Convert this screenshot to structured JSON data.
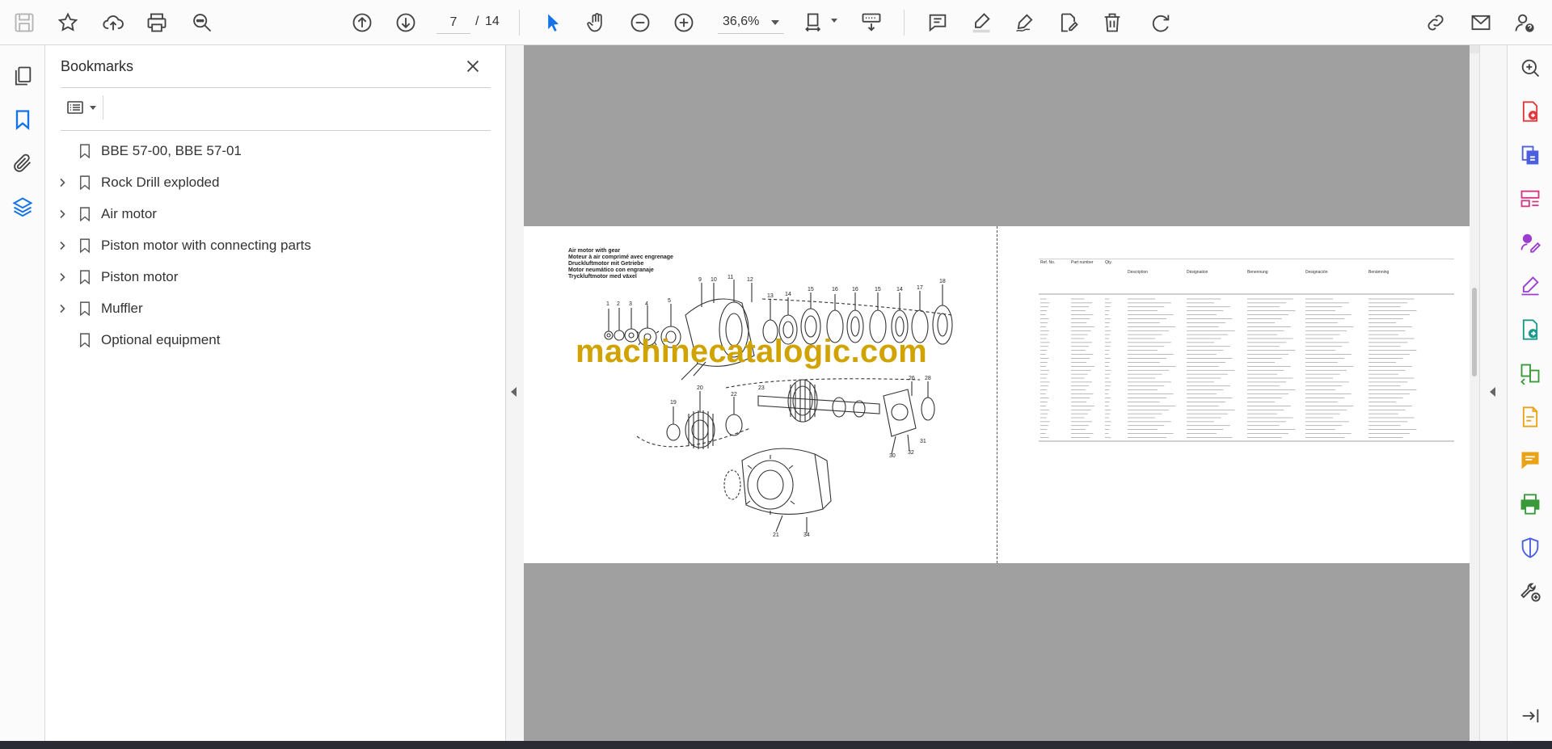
{
  "toolbar": {
    "page_current": "7",
    "page_separator": "/",
    "page_total": "14",
    "zoom": "36,6%"
  },
  "bookmarks": {
    "title": "Bookmarks",
    "items": [
      {
        "label": "BBE 57-00, BBE 57-01",
        "expandable": false
      },
      {
        "label": "Rock Drill exploded",
        "expandable": true
      },
      {
        "label": "Air motor",
        "expandable": true
      },
      {
        "label": "Piston motor with connecting parts",
        "expandable": true
      },
      {
        "label": "Piston motor",
        "expandable": true
      },
      {
        "label": "Muffler",
        "expandable": true
      },
      {
        "label": "Optional equipment",
        "expandable": false
      }
    ]
  },
  "document": {
    "watermark": "machinecatalogic.com",
    "caption_lines": [
      "Air motor with gear",
      "Moteur à air comprimé avec engrenage",
      "Druckluftmotor mit Getriebe",
      "Motor neumático con engranaje",
      "Tryckluftmotor med växel"
    ],
    "table_headers": [
      "Ref. No.",
      "Part number",
      "Qty.",
      "Description",
      "Désignation",
      "Benennung",
      "Designación",
      "Benämning"
    ]
  },
  "colors": {
    "accent_blue": "#1473e6",
    "watermark": "#d0a300",
    "doc_background": "#a0a0a0"
  }
}
